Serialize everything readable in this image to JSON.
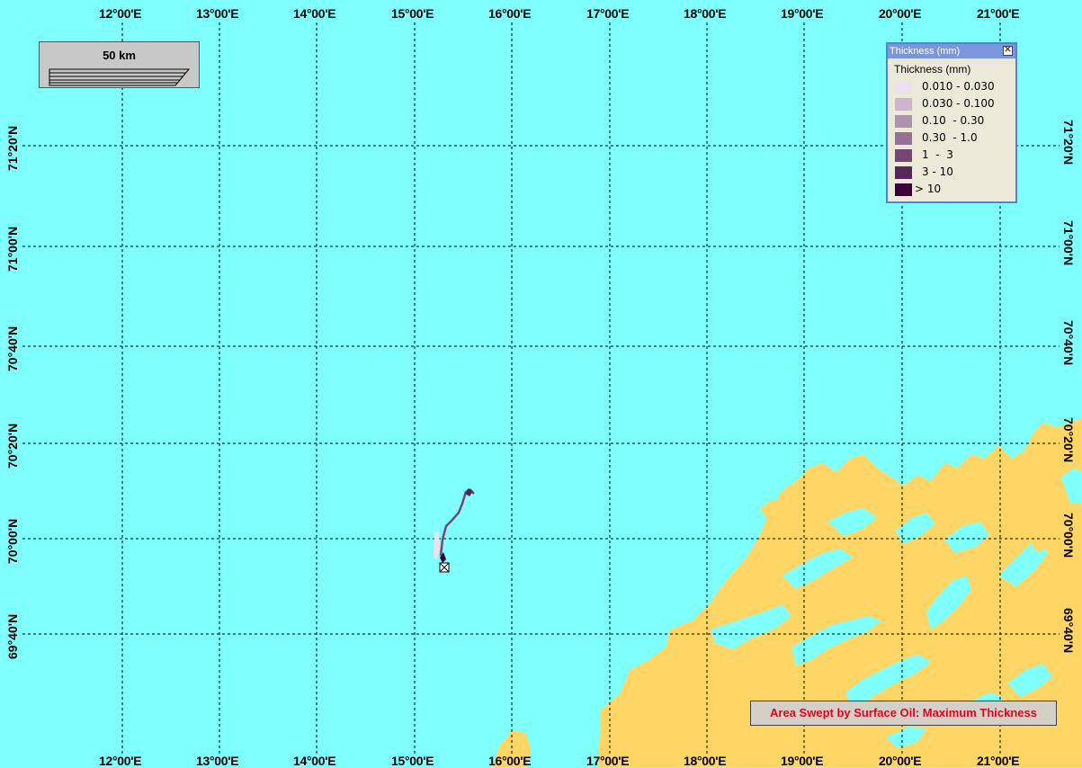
{
  "map": {
    "longitude_labels": [
      "12°00'E",
      "13°00'E",
      "14°00'E",
      "15°00'E",
      "16°00'E",
      "17°00'E",
      "18°00'E",
      "19°00'E",
      "20°00'E",
      "21°00'E"
    ],
    "latitude_labels": [
      "71°20'N",
      "71°00'N",
      "70°40'N",
      "70°20'N",
      "70°00'N",
      "69°40'N"
    ],
    "colors": {
      "sea": "#80ffff",
      "land": "#ffd666",
      "grid": "#000000"
    }
  },
  "scalebar": {
    "label": "50 km"
  },
  "legend": {
    "window_title": "Thickness (mm)",
    "heading": "Thickness (mm)",
    "close_glyph": "✕",
    "items": [
      {
        "label": "0.010 - 0.030",
        "color": "#ece1ec"
      },
      {
        "label": "0.030 - 0.100",
        "color": "#cdb6cd"
      },
      {
        "label": "0.10  - 0.30",
        "color": "#ae93ae"
      },
      {
        "label": "0.30  - 1.0",
        "color": "#967196"
      },
      {
        "label": "1  -  3",
        "color": "#764776"
      },
      {
        "label": "3 - 10",
        "color": "#592659"
      },
      {
        "label": "> 10",
        "color": "#3b003b"
      }
    ]
  },
  "caption": {
    "text": "Area Swept by Surface Oil: Maximum Thickness"
  }
}
